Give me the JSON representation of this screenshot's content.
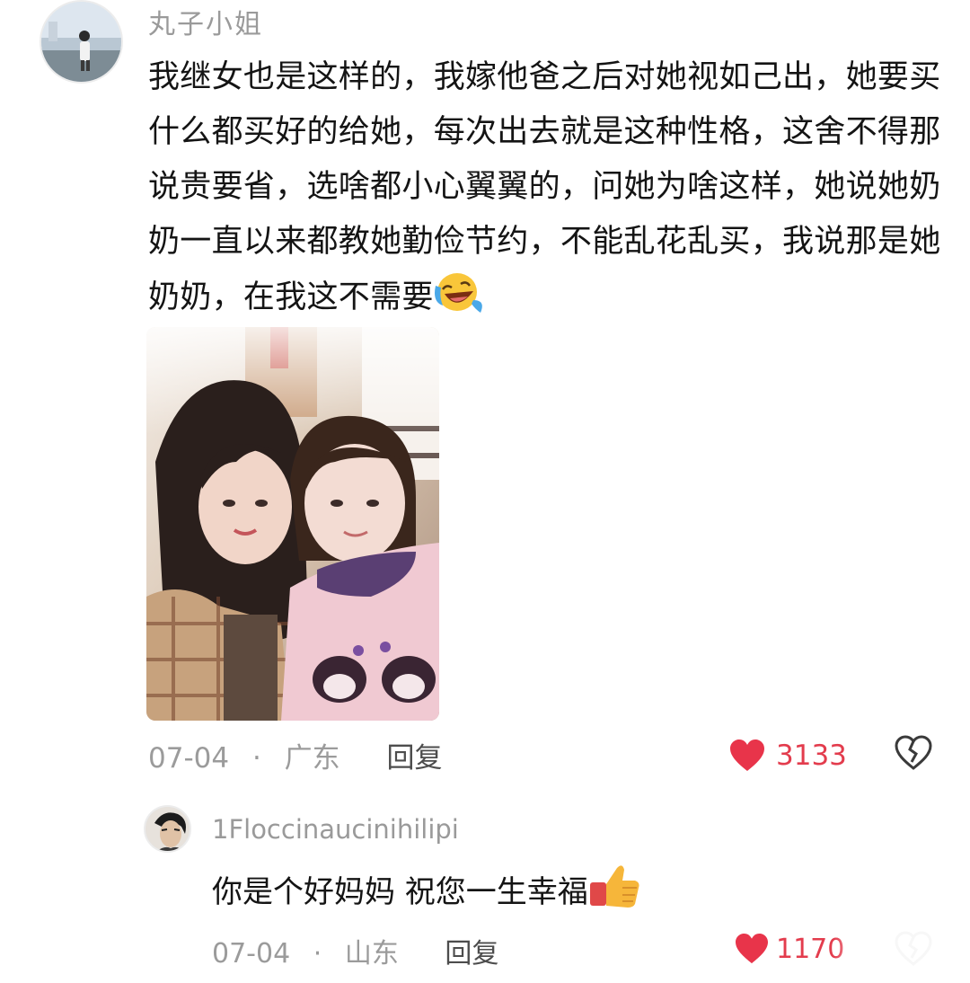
{
  "comments": [
    {
      "username": "丸子小姐",
      "text": "我继女也是这样的，我嫁他爸之后对她视如己出，她要买什么都买好的给她，每次出去就是这种性格，这舍不得那说贵要省，选啥都小心翼翼的，问她为啥这样，她说她奶奶一直以来都教她勤俭节约，不能乱花乱买，我说那是她奶奶，在我这不需要",
      "emoji": "laughing-crying-emoji",
      "date": "07-04",
      "separator": "·",
      "location": "广东",
      "reply_label": "回复",
      "likes": "3133",
      "has_photo": true
    },
    {
      "username": "1Floccinaucinihilipi",
      "text": "你是个好妈妈 祝您一生幸福",
      "emoji": "thumbs-up-emoji",
      "date": "07-04",
      "separator": "·",
      "location": "山东",
      "reply_label": "回复",
      "likes": "1170"
    }
  ],
  "colors": {
    "like_red": "#e33c4d",
    "meta_gray": "#9b9b9b",
    "text_black": "#141414"
  }
}
